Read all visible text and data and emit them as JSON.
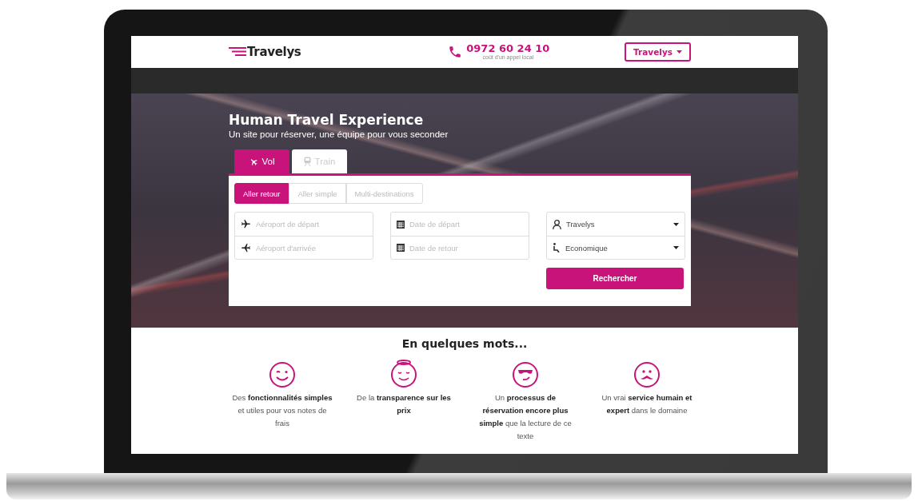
{
  "header": {
    "logo": "Travelys",
    "phone": "0972 60 24 10",
    "phone_note": "coût d'un appel local",
    "account_button": "Travelys"
  },
  "hero": {
    "title": "Human Travel Experience",
    "subtitle": "Un site pour réserver, une équipe pour vous seconder"
  },
  "transport_tabs": [
    {
      "label": "Vol",
      "kind": "plane",
      "selected": true
    },
    {
      "label": "Train",
      "kind": "train",
      "selected": false
    }
  ],
  "trip_types": [
    {
      "label": "Aller retour",
      "selected": true
    },
    {
      "label": "Aller simple",
      "selected": false
    },
    {
      "label": "Multi-destinations",
      "selected": false
    }
  ],
  "airport_fields": [
    {
      "placeholder": "Aéroport de départ",
      "kind": "departure"
    },
    {
      "placeholder": "Aéroport d'arrivée",
      "kind": "arrival"
    }
  ],
  "date_fields": [
    {
      "placeholder": "Date de départ"
    },
    {
      "placeholder": "Date de retour"
    }
  ],
  "selects": [
    {
      "value": "Travelys",
      "kind": "traveler"
    },
    {
      "value": "Economique",
      "kind": "cabin"
    }
  ],
  "search_button": "Rechercher",
  "features": {
    "title": "En quelques mots...",
    "items": [
      {
        "kind": "wink",
        "text": "Des **fonctionnalités simples** et utiles pour vos notes de frais"
      },
      {
        "kind": "angel",
        "text": "De la **transparence sur les prix**"
      },
      {
        "kind": "sunglasses",
        "text": "Un **processus de réservation encore plus simple** que la lecture de ce texte"
      },
      {
        "kind": "mustache",
        "text": "Un vrai **service humain et expert** dans le domaine"
      }
    ]
  }
}
